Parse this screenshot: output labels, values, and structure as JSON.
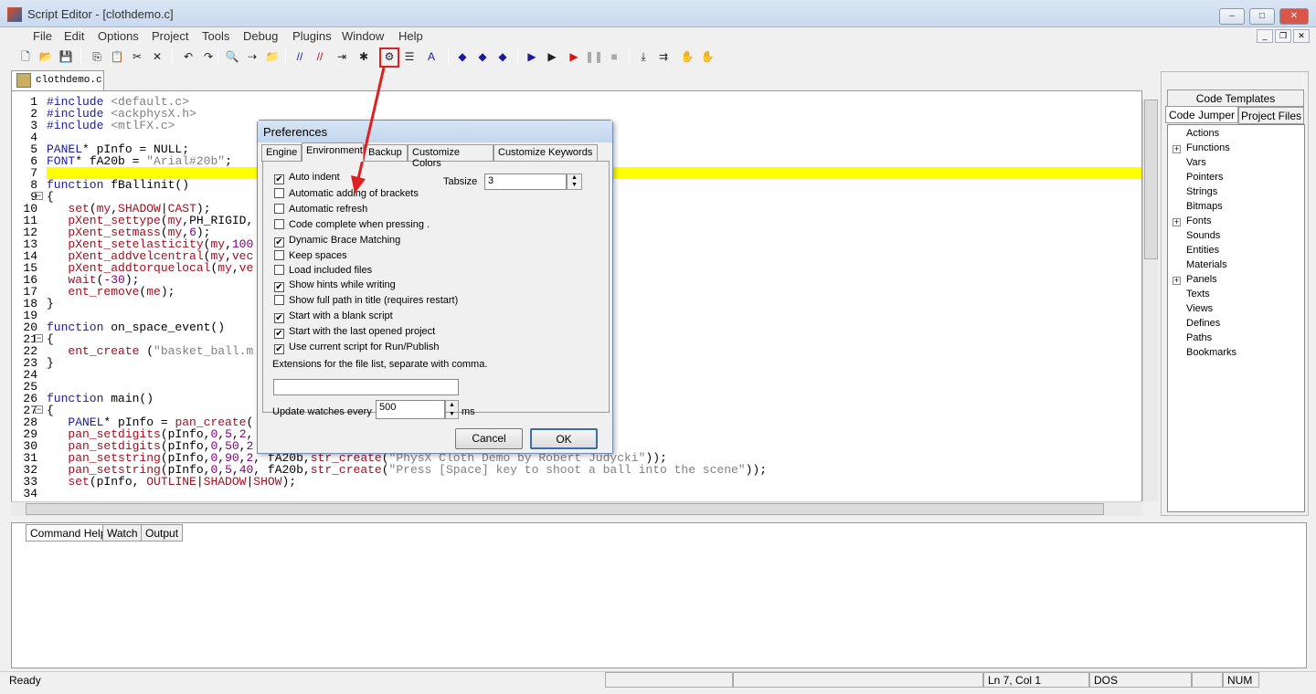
{
  "window": {
    "title": "Script Editor - [clothdemo.c]",
    "minimize": "–",
    "maximize": "□",
    "close": "✕"
  },
  "menu": [
    "File",
    "Edit",
    "Options",
    "Project",
    "Tools",
    "Debug",
    "Plugins",
    "Window",
    "Help"
  ],
  "doc_tab": "clothdemo.c",
  "code": [
    [
      [
        "#include ",
        "inc"
      ],
      [
        "<default.c>",
        "str"
      ]
    ],
    [
      [
        "#include ",
        "inc"
      ],
      [
        "<ackphysX.h>",
        "str"
      ]
    ],
    [
      [
        "#include ",
        "inc"
      ],
      [
        "<mtlFX.c>",
        "str"
      ]
    ],
    [],
    [
      [
        "PANEL",
        "kw"
      ],
      [
        "* pInfo = ",
        "id"
      ],
      [
        "NULL",
        "id"
      ],
      [
        ";",
        "id"
      ]
    ],
    [
      [
        "FONT",
        "kw"
      ],
      [
        "* fA20b = ",
        "id"
      ],
      [
        "\"Arial#20b\"",
        "str"
      ],
      [
        ";",
        "id"
      ]
    ],
    [],
    [
      [
        "function ",
        "kw"
      ],
      [
        "fBallinit()",
        "id"
      ]
    ],
    [
      [
        "{",
        "id"
      ]
    ],
    [
      [
        "   set",
        "fn"
      ],
      [
        "(",
        "id"
      ],
      [
        "my",
        "fn"
      ],
      [
        ",",
        "id"
      ],
      [
        "SHADOW",
        "fn"
      ],
      [
        "|",
        "id"
      ],
      [
        "CAST",
        "fn"
      ],
      [
        ");",
        "id"
      ]
    ],
    [
      [
        "   pXent_settype",
        "fn"
      ],
      [
        "(",
        "id"
      ],
      [
        "my",
        "fn"
      ],
      [
        ",",
        "id"
      ],
      [
        "PH_RIGID",
        "id"
      ],
      [
        ",",
        "id"
      ]
    ],
    [
      [
        "   pXent_setmass",
        "fn"
      ],
      [
        "(",
        "id"
      ],
      [
        "my",
        "fn"
      ],
      [
        ",",
        "id"
      ],
      [
        "6",
        "num"
      ],
      [
        ");",
        "id"
      ]
    ],
    [
      [
        "   pXent_setelasticity",
        "fn"
      ],
      [
        "(",
        "id"
      ],
      [
        "my",
        "fn"
      ],
      [
        ",",
        "id"
      ],
      [
        "100",
        "num"
      ]
    ],
    [
      [
        "   pXent_addvelcentral",
        "fn"
      ],
      [
        "(",
        "id"
      ],
      [
        "my",
        "fn"
      ],
      [
        ",",
        "id"
      ],
      [
        "vec",
        "fn"
      ]
    ],
    [
      [
        "   pXent_addtorquelocal",
        "fn"
      ],
      [
        "(",
        "id"
      ],
      [
        "my",
        "fn"
      ],
      [
        ",",
        "id"
      ],
      [
        "ve",
        "fn"
      ]
    ],
    [
      [
        "   wait",
        "fn"
      ],
      [
        "(",
        "id"
      ],
      [
        "-30",
        "num"
      ],
      [
        ");",
        "id"
      ]
    ],
    [
      [
        "   ent_remove",
        "fn"
      ],
      [
        "(",
        "id"
      ],
      [
        "me",
        "fn"
      ],
      [
        ");",
        "id"
      ]
    ],
    [
      [
        "}",
        "id"
      ]
    ],
    [],
    [
      [
        "function ",
        "kw"
      ],
      [
        "on_space_event()",
        "id"
      ]
    ],
    [
      [
        "{",
        "id"
      ]
    ],
    [
      [
        "   ent_create ",
        "fn"
      ],
      [
        "(",
        "id"
      ],
      [
        "\"basket_ball.m",
        "str"
      ]
    ],
    [
      [
        "}",
        "id"
      ]
    ],
    [],
    [],
    [
      [
        "function ",
        "kw"
      ],
      [
        "main()",
        "id"
      ]
    ],
    [
      [
        "{",
        "id"
      ]
    ],
    [
      [
        "   PANEL",
        "kw"
      ],
      [
        "* pInfo = ",
        "id"
      ],
      [
        "pan_create",
        "fn"
      ],
      [
        "(",
        "id"
      ]
    ],
    [
      [
        "   pan_setdigits",
        "fn"
      ],
      [
        "(pInfo,",
        "id"
      ],
      [
        "0",
        "num"
      ],
      [
        ",",
        "id"
      ],
      [
        "5",
        "num"
      ],
      [
        ",",
        "id"
      ],
      [
        "2",
        "num"
      ],
      [
        ",",
        "id"
      ]
    ],
    [
      [
        "   pan_setdigits",
        "fn"
      ],
      [
        "(pInfo,",
        "id"
      ],
      [
        "0",
        "num"
      ],
      [
        ",",
        "id"
      ],
      [
        "50",
        "num"
      ],
      [
        ",",
        "id"
      ],
      [
        "2",
        "num"
      ]
    ],
    [
      [
        "   pan_setstring",
        "fn"
      ],
      [
        "(pInfo,",
        "id"
      ],
      [
        "0",
        "num"
      ],
      [
        ",",
        "id"
      ],
      [
        "90",
        "num"
      ],
      [
        ",",
        "id"
      ],
      [
        "2",
        "num"
      ],
      [
        ", fA20b,",
        "id"
      ],
      [
        "str_create",
        "fn"
      ],
      [
        "(",
        "id"
      ],
      [
        "\"PhysX Cloth Demo by Robert Judycki\"",
        "str"
      ],
      [
        "));",
        "id"
      ]
    ],
    [
      [
        "   pan_setstring",
        "fn"
      ],
      [
        "(pInfo,",
        "id"
      ],
      [
        "0",
        "num"
      ],
      [
        ",",
        "id"
      ],
      [
        "5",
        "num"
      ],
      [
        ",",
        "id"
      ],
      [
        "40",
        "num"
      ],
      [
        ", fA20b,",
        "id"
      ],
      [
        "str_create",
        "fn"
      ],
      [
        "(",
        "id"
      ],
      [
        "\"Press [Space] key to shoot a ball into the scene\"",
        "str"
      ],
      [
        "));",
        "id"
      ]
    ],
    [
      [
        "   set",
        "fn"
      ],
      [
        "(pInfo, ",
        "id"
      ],
      [
        "OUTLINE",
        "fn"
      ],
      [
        "|",
        "id"
      ],
      [
        "SHADOW",
        "fn"
      ],
      [
        "|",
        "id"
      ],
      [
        "SHOW",
        "fn"
      ],
      [
        ");",
        "id"
      ]
    ],
    []
  ],
  "right_panel": {
    "tabs": [
      "Code Templates",
      "Code Jumper",
      "Project Files"
    ],
    "tree": [
      {
        "label": "Actions",
        "exp": false
      },
      {
        "label": "Functions",
        "exp": true
      },
      {
        "label": "Vars",
        "exp": false
      },
      {
        "label": "Pointers",
        "exp": false
      },
      {
        "label": "Strings",
        "exp": false
      },
      {
        "label": "Bitmaps",
        "exp": false
      },
      {
        "label": "Fonts",
        "exp": true
      },
      {
        "label": "Sounds",
        "exp": false
      },
      {
        "label": "Entities",
        "exp": false
      },
      {
        "label": "Materials",
        "exp": false
      },
      {
        "label": "Panels",
        "exp": true
      },
      {
        "label": "Texts",
        "exp": false
      },
      {
        "label": "Views",
        "exp": false
      },
      {
        "label": "Defines",
        "exp": false
      },
      {
        "label": "Paths",
        "exp": false
      },
      {
        "label": "Bookmarks",
        "exp": false
      }
    ]
  },
  "bottom_tabs": [
    "Command Help",
    "Watch",
    "Output"
  ],
  "status": {
    "text": "Ready",
    "position": "Ln 7, Col 1",
    "line_ending": "DOS",
    "num": "NUM"
  },
  "dialog": {
    "title": "Preferences",
    "tabs": [
      "Engine",
      "Environment",
      "Backup",
      "Customize Colors",
      "Customize Keywords"
    ],
    "options": [
      {
        "label": "Auto indent",
        "checked": true
      },
      {
        "label": "Automatic adding of brackets",
        "checked": false
      },
      {
        "label": "Automatic refresh",
        "checked": false
      },
      {
        "label": "Code complete when pressing .",
        "checked": false
      },
      {
        "label": "Dynamic Brace Matching",
        "checked": true
      },
      {
        "label": "Keep spaces",
        "checked": false
      },
      {
        "label": "Load included files",
        "checked": false
      },
      {
        "label": "Show hints while writing",
        "checked": true
      },
      {
        "label": "Show full path in title (requires restart)",
        "checked": false
      },
      {
        "label": "Start with a blank script",
        "checked": true
      },
      {
        "label": "Start with the last opened project",
        "checked": true
      },
      {
        "label": "Use current script for Run/Publish",
        "checked": true
      }
    ],
    "tabsize_label": "Tabsize",
    "tabsize": "3",
    "extensions_label": "Extensions for the file list, separate with comma.",
    "extensions": "",
    "watch_label": "Update watches every",
    "watch_value": "500",
    "watch_unit": "ms",
    "cancel": "Cancel",
    "ok": "OK"
  },
  "colors": {
    "highlight_line": "#ffff00",
    "annotation": "#e02020"
  }
}
